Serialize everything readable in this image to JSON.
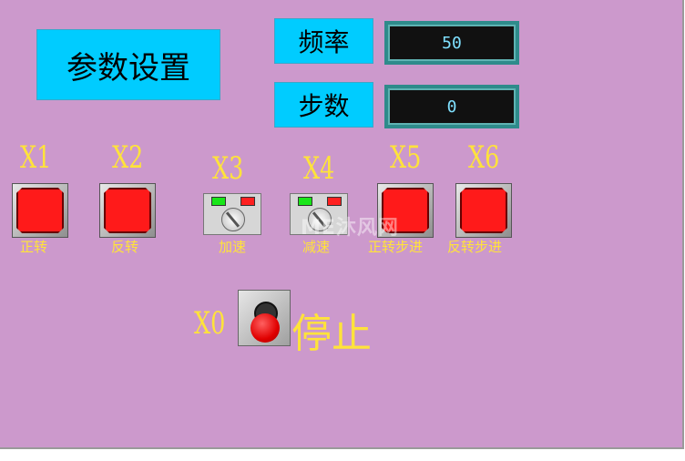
{
  "params_title": "参数设置",
  "frequency": {
    "label": "频率",
    "value": "50"
  },
  "steps": {
    "label": "步数",
    "value": "0"
  },
  "buttons": [
    {
      "id": "X1",
      "caption": "正转"
    },
    {
      "id": "X2",
      "caption": "反转"
    },
    {
      "id": "X3",
      "caption": "加速"
    },
    {
      "id": "X4",
      "caption": "减速"
    },
    {
      "id": "X5",
      "caption": "正转步进"
    },
    {
      "id": "X6",
      "caption": "反转步进"
    }
  ],
  "stop": {
    "id": "X0",
    "caption": "停止"
  },
  "watermark": "ME沐风网",
  "colors": {
    "background": "#cc99cc",
    "label_yellow": "#ffe33a",
    "cyan": "#00ccff",
    "button_red": "#ff1a1a"
  }
}
